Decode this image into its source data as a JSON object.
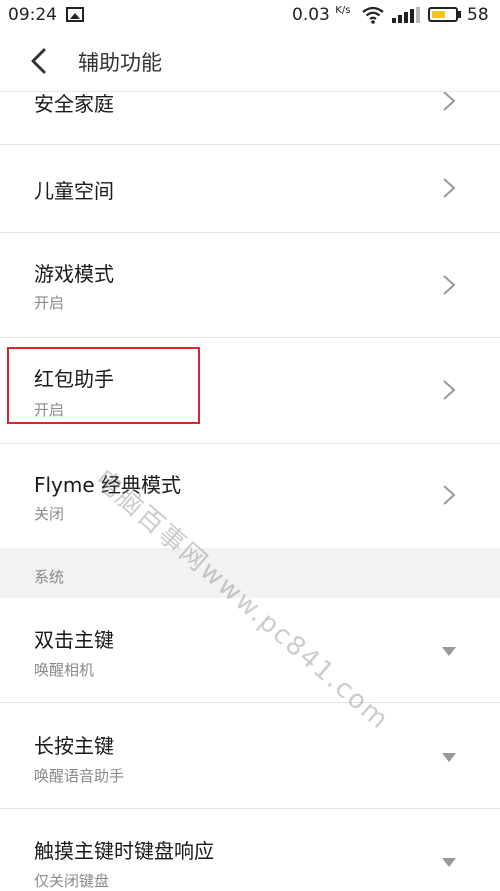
{
  "status_bar": {
    "time": "09:24",
    "net_speed_value": "0.03",
    "net_speed_unit": "K/s",
    "battery_percent": "58",
    "battery_level": 0.58
  },
  "header": {
    "title": "辅助功能"
  },
  "items_top": [
    {
      "title": "安全家庭"
    },
    {
      "title": "儿童空间"
    },
    {
      "title": "游戏模式",
      "subtitle": "开启"
    },
    {
      "title": "红包助手",
      "subtitle": "开启"
    },
    {
      "title": "Flyme 经典模式",
      "subtitle": "关闭"
    }
  ],
  "section": {
    "label": "系统"
  },
  "items_system": [
    {
      "title": "双击主键",
      "subtitle": "唤醒相机"
    },
    {
      "title": "长按主键",
      "subtitle": "唤醒语音助手"
    },
    {
      "title": "触摸主键时键盘响应",
      "subtitle": "仅关闭键盘"
    }
  ],
  "watermark": "电脑百事网www.pc841.com",
  "colors": {
    "highlight_border": "#d8262e",
    "battery_fill": "#f5c518",
    "section_bg": "#f2f2f2"
  }
}
